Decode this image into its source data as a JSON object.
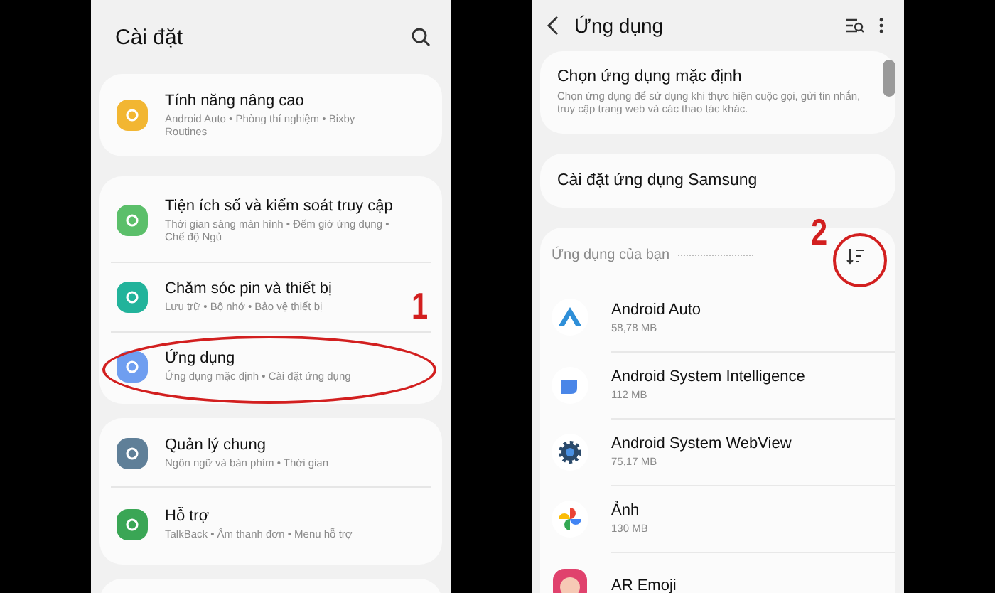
{
  "settings_screen": {
    "title": "Cài đặt",
    "groups": [
      {
        "items": [
          {
            "title": "Tính năng nâng cao",
            "subtitle": "Android Auto  •  Phòng thí nghiệm  •  Bixby Routines",
            "color": "#f2b632",
            "highlighted": false
          }
        ]
      },
      {
        "items": [
          {
            "title": "Tiện ích số và kiểm soát truy cập",
            "subtitle": "Thời gian sáng màn hình  •  Đếm giờ ứng dụng  •  Chế độ Ngủ",
            "color": "#5bbf6a",
            "highlighted": false
          },
          {
            "title": "Chăm sóc pin và thiết bị",
            "subtitle": "Lưu trữ  •  Bộ nhớ  •  Bảo vệ thiết bị",
            "color": "#22b39b",
            "highlighted": false
          },
          {
            "title": "Ứng dụng",
            "subtitle": "Ứng dụng mặc định  •  Cài đặt ứng dụng",
            "color": "#6f9ef0",
            "highlighted": true
          }
        ]
      },
      {
        "items": [
          {
            "title": "Quản lý chung",
            "subtitle": "Ngôn ngữ và bàn phím  •  Thời gian",
            "color": "#5f7f98",
            "highlighted": false
          },
          {
            "title": "Hỗ trợ",
            "subtitle": "TalkBack  •  Âm thanh đơn  •  Menu hỗ trợ",
            "color": "#3aa655",
            "highlighted": false
          }
        ]
      }
    ],
    "step_label": "1"
  },
  "apps_screen": {
    "title": "Ứng dụng",
    "default_apps": {
      "title": "Chọn ứng dụng mặc định",
      "description": "Chọn ứng dụng để sử dụng khi thực hiện cuộc gọi, gửi tin nhắn, truy cập trang web và các thao tác khác."
    },
    "samsung_settings": "Cài đặt ứng dụng Samsung",
    "section_title": "Ứng dụng của bạn",
    "step_label": "2",
    "apps": [
      {
        "name": "Android Auto",
        "size": "58,78 MB",
        "kind": "auto"
      },
      {
        "name": "Android System Intelligence",
        "size": "112 MB",
        "kind": "intelligence"
      },
      {
        "name": "Android System WebView",
        "size": "75,17 MB",
        "kind": "webview"
      },
      {
        "name": "Ảnh",
        "size": "130 MB",
        "kind": "photos"
      },
      {
        "name": "AR Emoji",
        "kind": "emoji"
      }
    ]
  }
}
